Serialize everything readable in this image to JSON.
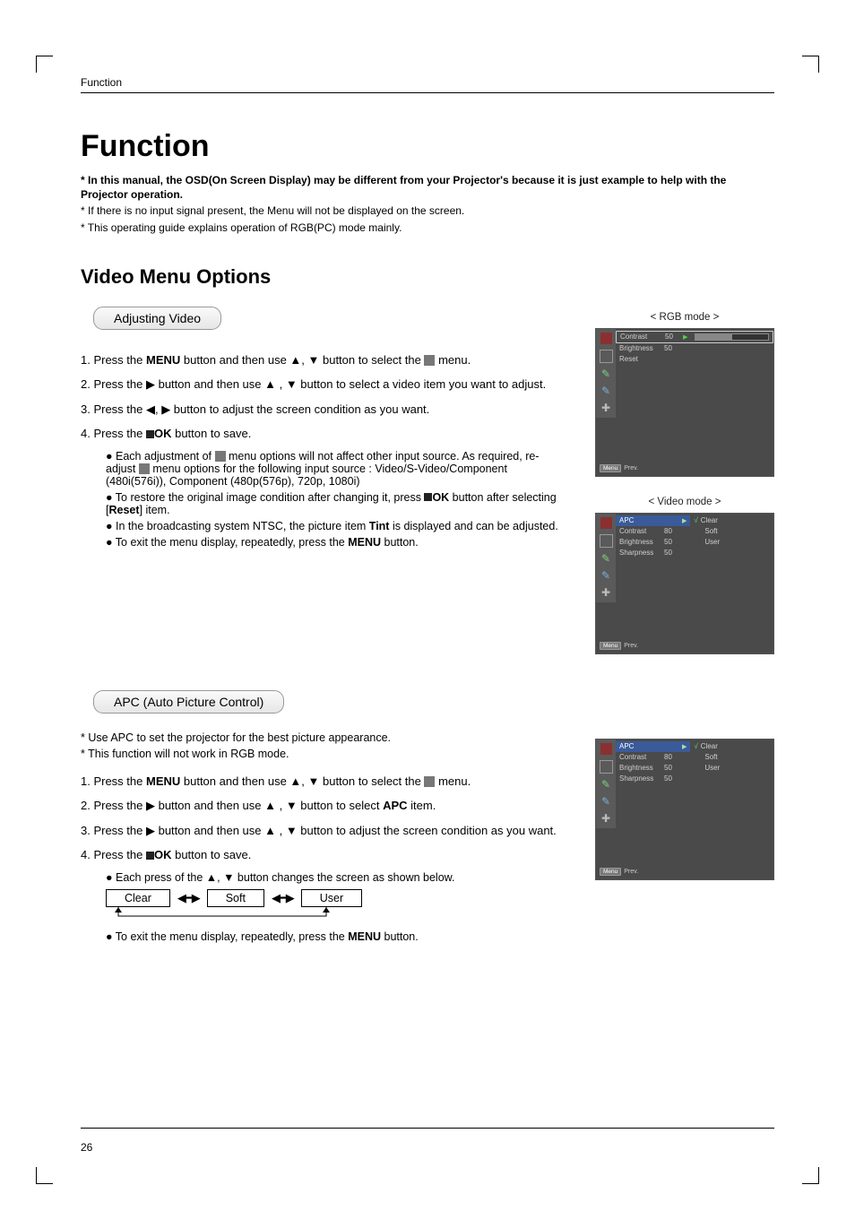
{
  "header_label": "Function",
  "main_title": "Function",
  "notes": {
    "bold": "* In this manual, the OSD(On Screen Display) may be different from your Projector's because it is just example to help with the Projector operation.",
    "l2": "* If there is no input signal present, the Menu will not be displayed on the screen.",
    "l3": "* This operating guide explains operation of RGB(PC) mode mainly."
  },
  "section_title": "Video Menu Options",
  "adj": {
    "heading": "Adjusting Video",
    "s1a": "1. Press the ",
    "menu": "MENU",
    "s1b": " button and then use ▲, ▼ button to select the ",
    "s1c": " menu.",
    "s2": "2. Press the ▶ button and then use ▲ , ▼ button to select a video item you want to adjust.",
    "s3": "3. Press the ◀, ▶ button to adjust the screen condition as you want.",
    "s4a": "4. Press the ",
    "ok": "OK",
    "s4b": " button to save.",
    "b1a": "● Each adjustment of ",
    "b1b": " menu options will not affect other input source. As required, re-adjust ",
    "b1c": " menu options for the following input source : Video/S-Video/Component (480i(576i)), Component (480p(576p), 720p, 1080i)",
    "b2a": "● To restore the original image condition after changing it, press ",
    "b2b": " button after selecting [",
    "reset": "Reset",
    "b2c": "] item.",
    "b3a": "● In the broadcasting system NTSC, the picture item ",
    "tint": "Tint",
    "b3b": " is displayed and can be adjusted.",
    "b4a": "● To exit the menu display, repeatedly, press the ",
    "b4b": " button."
  },
  "apc": {
    "heading": "APC (Auto Picture Control)",
    "i1": "* Use APC to set the projector for the best picture appearance.",
    "i2": "* This function will not work in RGB mode.",
    "s1a": "1. Press the ",
    "s1b": " button and then use ▲, ▼ button to select the ",
    "s1c": " menu.",
    "s2a": "2. Press the ▶ button and then use ▲ , ▼ button to select ",
    "apc_word": "APC",
    "s2b": " item.",
    "s3": "3. Press the ▶ button and then use ▲ , ▼ button to adjust the screen condition as you want.",
    "s4a": "4. Press the ",
    "s4b": " button to save.",
    "b1": "● Each press of the ▲, ▼ button changes the screen as shown below.",
    "flow_clear": "Clear",
    "flow_soft": "Soft",
    "flow_user": "User",
    "b2a": "● To exit the menu display, repeatedly, press the ",
    "b2b": " button."
  },
  "osd": {
    "rgb_label": "< RGB mode >",
    "video_label": "< Video mode >",
    "menu_btn": "Menu",
    "prev": "Prev.",
    "rgb": {
      "rows": [
        {
          "label": "Contrast",
          "value": "50",
          "arrow": true,
          "selected": true,
          "bar": true
        },
        {
          "label": "Brightness",
          "value": "50"
        },
        {
          "label": "Reset",
          "value": ""
        }
      ]
    },
    "video": {
      "rows": [
        {
          "label": "APC",
          "value": "",
          "arrow": true,
          "blue": true
        },
        {
          "label": "Contrast",
          "value": "80"
        },
        {
          "label": "Brightness",
          "value": "50"
        },
        {
          "label": "Sharpness",
          "value": "50"
        }
      ],
      "sub": [
        {
          "label": "Clear",
          "tick": true
        },
        {
          "label": "Soft"
        },
        {
          "label": "User"
        }
      ]
    },
    "apc_osd": {
      "rows": [
        {
          "label": "APC",
          "value": "",
          "arrow": true,
          "blue": true
        },
        {
          "label": "Contrast",
          "value": "80"
        },
        {
          "label": "Brightness",
          "value": "50"
        },
        {
          "label": "Sharpness",
          "value": "50"
        }
      ],
      "sub": [
        {
          "label": "Clear",
          "tick": true
        },
        {
          "label": "Soft"
        },
        {
          "label": "User"
        }
      ]
    }
  },
  "page_number": "26"
}
